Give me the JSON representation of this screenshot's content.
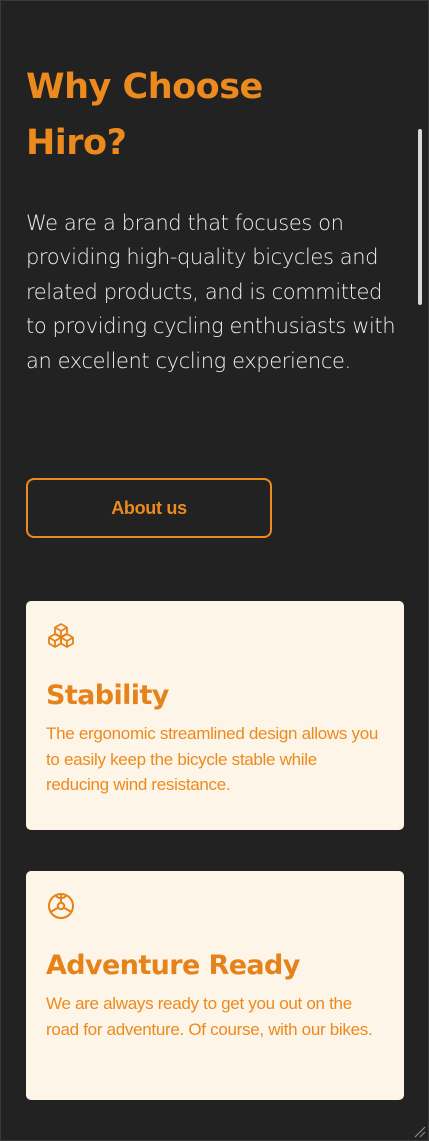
{
  "hero": {
    "title_line1": "Why Choose",
    "title_line2": "Hiro?",
    "intro": "We are a brand that focuses on providing high-quality bicycles and related products, and is committed to providing cycling enthusiasts with an excellent cycling experience.",
    "about_button": "About us"
  },
  "features": [
    {
      "icon": "cubes-icon",
      "title": "Stability",
      "text": "The ergonomic streamlined design allows you to easily keep the bicycle stable while reducing wind resistance."
    },
    {
      "icon": "wheel-icon",
      "title": "Adventure Ready",
      "text": "We are always ready to get you out on the road for adventure. Of course, with our bikes."
    }
  ],
  "colors": {
    "background": "#222222",
    "accent": "#ec8a1e",
    "card_background": "#fdf5e8",
    "text_light": "#efefef"
  }
}
